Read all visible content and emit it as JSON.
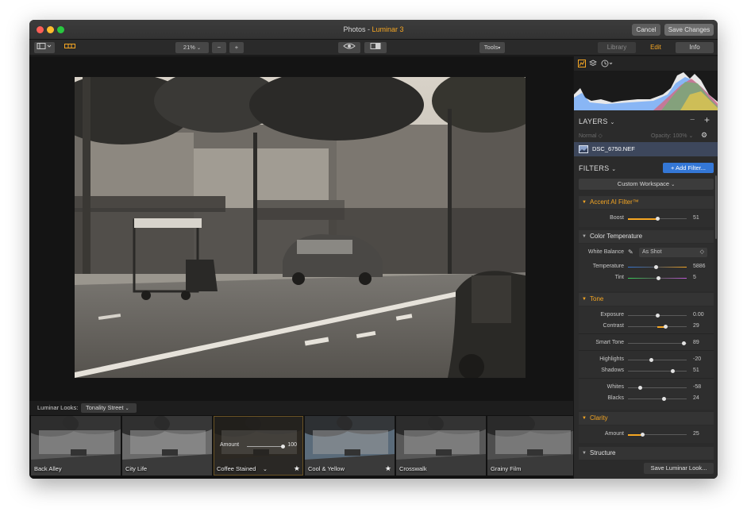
{
  "window": {
    "title_main": "Photos",
    "title_sep": " - ",
    "title_app": "Luminar 3",
    "cancel": "Cancel",
    "save_changes": "Save Changes"
  },
  "toolbar": {
    "zoom": "21%",
    "zoom_minus": "−",
    "zoom_plus": "+",
    "tools": "Tools",
    "library": "Library",
    "edit": "Edit",
    "info": "Info"
  },
  "looks": {
    "label": "Luminar Looks:",
    "category": "Tonality Street",
    "amount_label": "Amount",
    "amount_value": "100",
    "items": [
      {
        "name": "Back Alley",
        "selected": false,
        "favorite": false
      },
      {
        "name": "City Life",
        "selected": false,
        "favorite": false
      },
      {
        "name": "Coffee Stained",
        "selected": true,
        "favorite": true
      },
      {
        "name": "Cool & Yellow",
        "selected": false,
        "favorite": true
      },
      {
        "name": "Crosswalk",
        "selected": false,
        "favorite": false
      },
      {
        "name": "Grainy Film",
        "selected": false,
        "favorite": false
      }
    ]
  },
  "layers": {
    "title": "LAYERS",
    "blend": "Normal",
    "opacity": "Opacity: 100%",
    "file": "DSC_6750.NEF"
  },
  "filters": {
    "title": "FILTERS",
    "add_button": "+ Add Filter...",
    "workspace": "Custom Workspace",
    "accent": {
      "title": "Accent AI Filter™",
      "boost_label": "Boost",
      "boost_value": "51",
      "boost_pos": 0.51
    },
    "color_temp": {
      "title": "Color Temperature",
      "wb_label": "White Balance",
      "wb_value": "As Shot",
      "temperature_label": "Temperature",
      "temperature_value": "5886",
      "temperature_pos": 0.48,
      "tint_label": "Tint",
      "tint_value": "5",
      "tint_pos": 0.52
    },
    "tone": {
      "title": "Tone",
      "exposure_label": "Exposure",
      "exposure_value": "0.00",
      "exposure_pos": 0.5,
      "contrast_label": "Contrast",
      "contrast_value": "29",
      "contrast_pos": 0.64,
      "smart_label": "Smart Tone",
      "smart_value": "89",
      "smart_pos": 0.95,
      "highlights_label": "Highlights",
      "highlights_value": "-20",
      "highlights_pos": 0.4,
      "shadows_label": "Shadows",
      "shadows_value": "51",
      "shadows_pos": 0.76,
      "whites_label": "Whites",
      "whites_value": "-58",
      "whites_pos": 0.21,
      "blacks_label": "Blacks",
      "blacks_value": "24",
      "blacks_pos": 0.62
    },
    "clarity": {
      "title": "Clarity",
      "amount_label": "Amount",
      "amount_value": "25",
      "amount_pos": 0.25
    },
    "structure": {
      "title": "Structure"
    },
    "save_look": "Save Luminar Look..."
  },
  "colors": {
    "accent": "#f5a623",
    "add_filter": "#3477d6",
    "layer_row": "#3d475c"
  }
}
